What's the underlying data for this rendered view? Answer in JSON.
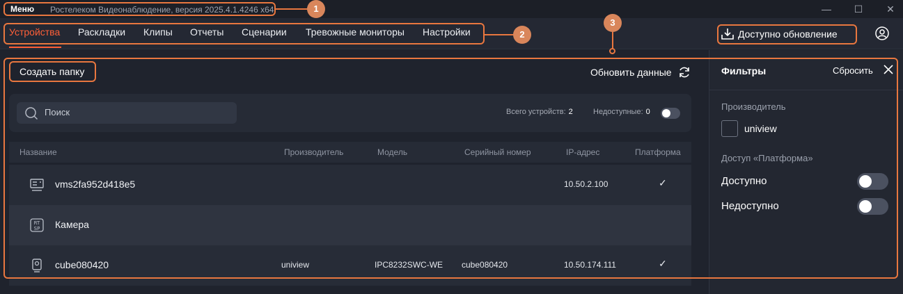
{
  "titlebar": {
    "menu_label": "Меню",
    "app_title": "Ростелеком Видеонаблюдение, версия 2025.4.1.4246 x64",
    "minimize_symbol": "—",
    "maximize_symbol": "☐",
    "close_symbol": "✕"
  },
  "nav": {
    "tabs": [
      {
        "label": "Устройства",
        "active": true
      },
      {
        "label": "Раскладки"
      },
      {
        "label": "Клипы"
      },
      {
        "label": "Отчеты"
      },
      {
        "label": "Сценарии"
      },
      {
        "label": "Тревожные мониторы"
      },
      {
        "label": "Настройки"
      }
    ],
    "update_label": "Доступно обновление"
  },
  "main": {
    "create_folder_label": "Создать папку",
    "refresh_label": "Обновить данные",
    "search_placeholder": "Поиск",
    "total_label": "Всего устройств:",
    "total_value": "2",
    "unavailable_label": "Недоступные:",
    "unavailable_value": "0",
    "columns": [
      "Название",
      "Производитель",
      "Модель",
      "Серийный номер",
      "IP-адрес",
      "Платформа"
    ],
    "rows": [
      {
        "icon": "server-icon",
        "name": "vms2fa952d418e5",
        "vendor": "",
        "model": "",
        "serial": "",
        "ip": "10.50.2.100",
        "platform": "✓"
      },
      {
        "icon": "rtsp-icon",
        "icon_text": "RT SP",
        "name": "Камера",
        "vendor": "",
        "model": "",
        "serial": "",
        "ip": "",
        "platform": ""
      },
      {
        "icon": "camera-icon",
        "name": "cube080420",
        "vendor": "uniview",
        "model": "IPC8232SWC-WE",
        "serial": "cube080420",
        "ip": "10.50.174.111",
        "platform": "✓"
      }
    ]
  },
  "filters": {
    "title": "Фильтры",
    "reset_label": "Сбросить",
    "manufacturer_label": "Производитель",
    "manufacturer_option": "uniview",
    "access_label": "Доступ «Платформа»",
    "available_label": "Доступно",
    "unavailable_label": "Недоступно"
  },
  "annotations": {
    "badges": [
      "1",
      "2",
      "3"
    ],
    "color": "#e9773f"
  },
  "colors": {
    "accent": "#ff5f38",
    "background": "#1e222c"
  }
}
